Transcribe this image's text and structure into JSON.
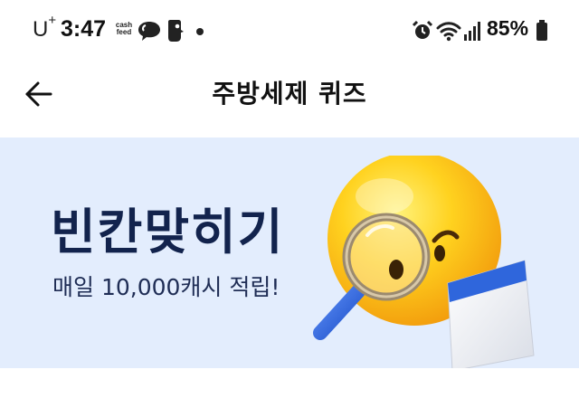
{
  "status_bar": {
    "carrier": "U",
    "carrier_sup": "+",
    "time": "3:47",
    "app_badge_line1": "cash",
    "app_badge_line2": "feed",
    "icons": [
      "talk-icon",
      "notification-icon",
      "alarm-icon",
      "wifi-icon",
      "signal-icon",
      "battery-icon"
    ],
    "battery": "85%"
  },
  "header": {
    "back_icon": "arrow-left-icon",
    "title": "주방세제 퀴즈"
  },
  "banner": {
    "title": "빈칸맞히기",
    "subtitle": "매일 10,000캐시 적립!",
    "background": "#e3edfd",
    "title_color": "#12234d"
  }
}
